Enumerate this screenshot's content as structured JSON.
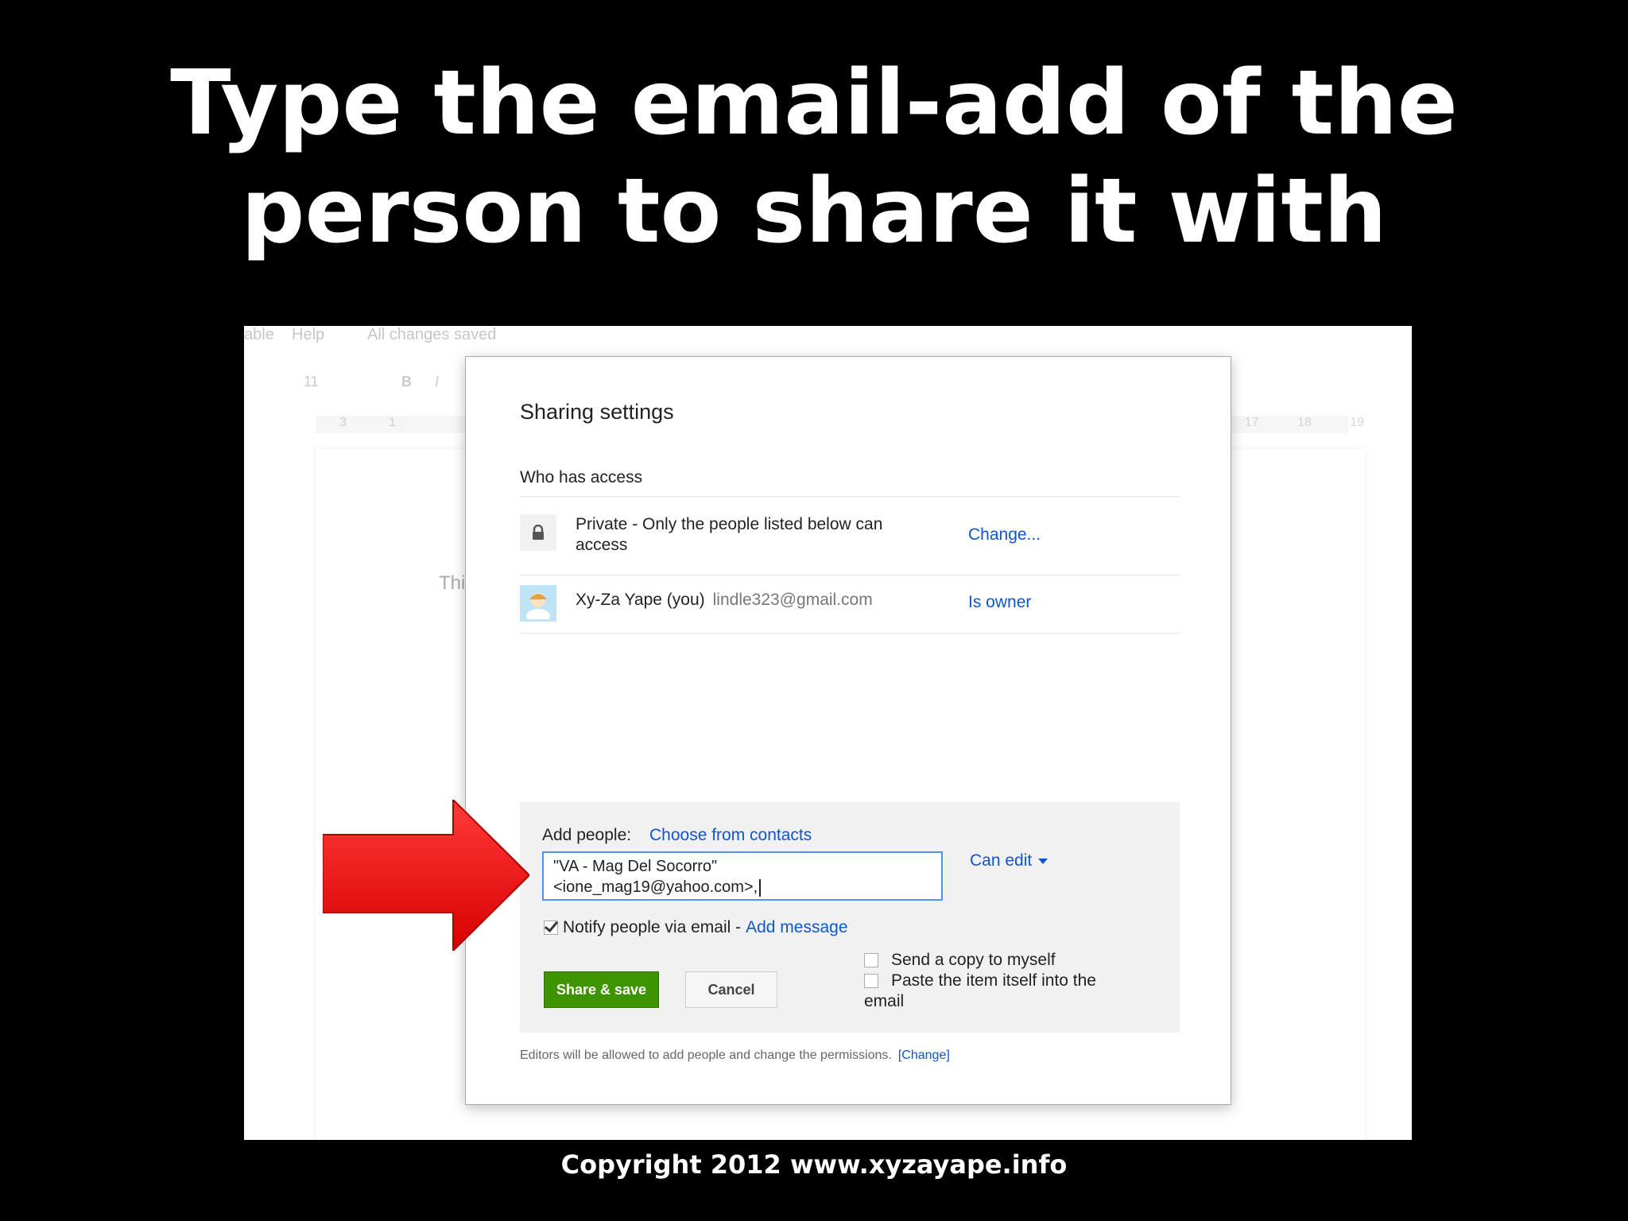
{
  "slide": {
    "title_line1": "Type the email-add of the",
    "title_line2": "person to share it with",
    "copyright": "Copyright 2012 www.xyzayape.info"
  },
  "background_app": {
    "menu_items": [
      "able",
      "Help",
      "All changes saved"
    ],
    "toolbar_font_size": "11",
    "toolbar_bold": "B",
    "toolbar_italic": "I",
    "ruler_left": [
      "3",
      "1"
    ],
    "ruler_right": [
      "17",
      "18",
      "19"
    ],
    "doc_text_fragment": "Thi"
  },
  "dialog": {
    "title": "Sharing settings",
    "who_has_access_label": "Who has access",
    "access_rows": [
      {
        "icon": "lock-icon",
        "text": "Private - Only the people listed below can access",
        "action": "Change..."
      },
      {
        "icon": "avatar",
        "name": "Xy-Za Yape (you)",
        "email": "lindle323@gmail.com",
        "action": "Is owner"
      }
    ],
    "add_people": {
      "label": "Add people:",
      "choose_contacts": "Choose from contacts",
      "input_line1": "\"VA - Mag Del Socorro\"",
      "input_line2": "<ione_mag19@yahoo.com>,",
      "permission": "Can edit",
      "notify_label": "Notify people via email -",
      "notify_checked": true,
      "add_message": "Add message",
      "send_copy": "Send a copy to myself",
      "paste_item": "Paste the item itself into the email",
      "share_button": "Share & save",
      "cancel_button": "Cancel"
    },
    "footnote": "Editors will be allowed to add people and change the permissions.",
    "footnote_link": "[Change]"
  },
  "colors": {
    "link": "#1155cc",
    "share_button": "#3d9400",
    "arrow": "#ff0000"
  }
}
